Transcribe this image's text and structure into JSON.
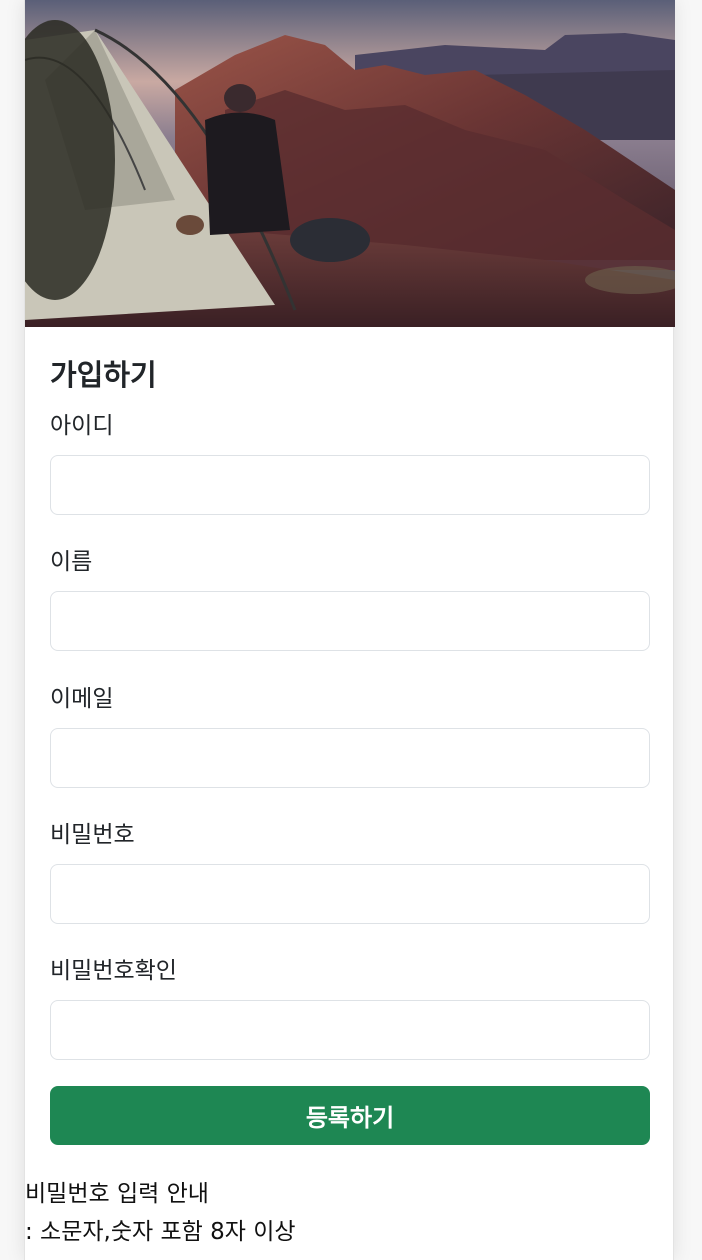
{
  "hero": {
    "image": "camping-tent-canyon-sunset-photo"
  },
  "form": {
    "title": "가입하기",
    "fields": [
      {
        "label": "아이디",
        "value": "",
        "placeholder": ""
      },
      {
        "label": "이름",
        "value": "",
        "placeholder": ""
      },
      {
        "label": "이메일",
        "value": "",
        "placeholder": ""
      },
      {
        "label": "비밀번호",
        "value": "",
        "placeholder": ""
      },
      {
        "label": "비밀번호확인",
        "value": "",
        "placeholder": ""
      }
    ],
    "submit_label": "등록하기"
  },
  "notice": {
    "line1": "비밀번호 입력 안내",
    "line2": ": 소문자,숫자 포함 8자 이상"
  },
  "colors": {
    "accent": "#1e8753",
    "input_border": "#dee2e6",
    "text": "#212529"
  }
}
